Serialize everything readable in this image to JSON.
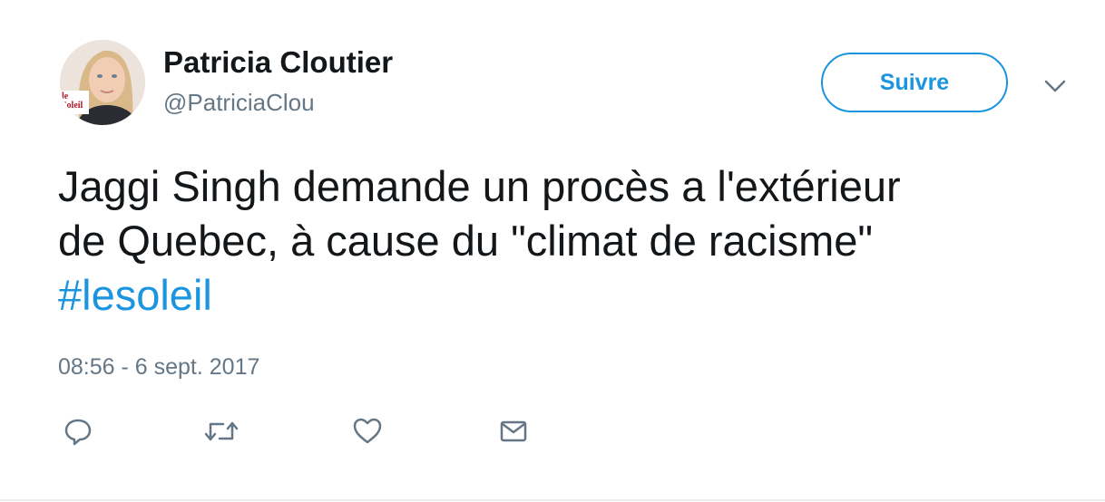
{
  "author": {
    "name": "Patricia Cloutier",
    "handle": "@PatriciaClou",
    "avatar_badge": "le Soleil"
  },
  "follow_button": {
    "label": "Suivre"
  },
  "tweet": {
    "line1": "Jaggi Singh demande un procès a l'extérieur",
    "line2": "de Quebec, à cause du \"climat de racisme\"",
    "hashtag": "#lesoleil",
    "timestamp": "08:56 - 6 sept. 2017"
  },
  "actions": [
    "reply-icon",
    "retweet-icon",
    "like-icon",
    "message-icon"
  ],
  "colors": {
    "link": "#1b95e0",
    "text": "#14171a",
    "muted": "#657786",
    "icon": "#657786"
  }
}
